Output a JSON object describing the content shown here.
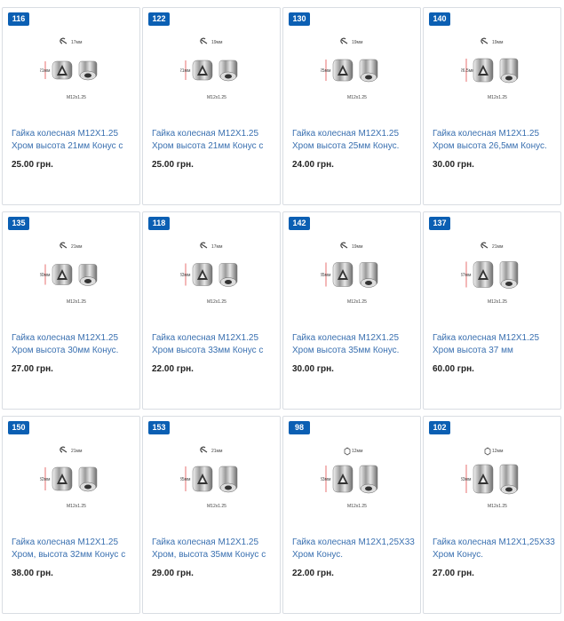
{
  "colors": {
    "badge": "#0b5fb3",
    "title_link": "#3a70b0",
    "border": "#d9dde3"
  },
  "products": [
    {
      "badge": "116",
      "size_label": "17мм",
      "height_label": "21мм",
      "thread_label": "M12x1.25",
      "title": "Гайка колесная M12X1.25 Хром высота 21мм Конус с",
      "price": "25.00 грн.",
      "icon": "wrench-icon"
    },
    {
      "badge": "122",
      "size_label": "19мм",
      "height_label": "21мм",
      "thread_label": "M12x1.25",
      "title": "Гайка колесная M12X1.25 Хром высота 21мм Конус с",
      "price": "25.00 грн.",
      "icon": "wrench-icon"
    },
    {
      "badge": "130",
      "size_label": "19мм",
      "height_label": "25мм",
      "thread_label": "M12x1.25",
      "title": "Гайка колесная M12X1.25 Хром высота 25мм Конус.",
      "price": "24.00 грн.",
      "icon": "wrench-icon"
    },
    {
      "badge": "140",
      "size_label": "19мм",
      "height_label": "26.5мм",
      "thread_label": "M12x1.25",
      "title": "Гайка колесная M12X1.25 Хром высота 26,5мм Конус.",
      "price": "30.00 грн.",
      "icon": "wrench-icon"
    },
    {
      "badge": "135",
      "size_label": "21мм",
      "height_label": "30мм",
      "thread_label": "M12x1.25",
      "title": "Гайка колесная M12X1.25 Хром высота 30мм Конус.",
      "price": "27.00 грн.",
      "icon": "wrench-icon"
    },
    {
      "badge": "118",
      "size_label": "17мм",
      "height_label": "33мм",
      "thread_label": "M12x1.25",
      "title": "Гайка колесная M12X1.25 Хром высота 33мм Конус с",
      "price": "22.00 грн.",
      "icon": "wrench-icon"
    },
    {
      "badge": "142",
      "size_label": "19мм",
      "height_label": "35мм",
      "thread_label": "M12x1.25",
      "title": "Гайка колесная M12X1.25 Хром высота 35мм Конус.",
      "price": "30.00 грн.",
      "icon": "wrench-icon"
    },
    {
      "badge": "137",
      "size_label": "21мм",
      "height_label": "37мм",
      "thread_label": "M12x1.25",
      "title": "Гайка колесная M12X1.25 Хром высота 37 мм",
      "price": "60.00 грн.",
      "icon": "wrench-icon"
    },
    {
      "badge": "150",
      "size_label": "21мм",
      "height_label": "32мм",
      "thread_label": "M12x1.25",
      "title": "Гайка колесная M12X1.25 Хром, высота 32мм Конус с",
      "price": "38.00 грн.",
      "icon": "wrench-icon"
    },
    {
      "badge": "153",
      "size_label": "21мм",
      "height_label": "35мм",
      "thread_label": "M12x1.25",
      "title": "Гайка колесная M12X1.25 Хром, высота 35мм Конус с",
      "price": "29.00 грн.",
      "icon": "wrench-icon"
    },
    {
      "badge": "98",
      "size_label": "12мм",
      "height_label": "33мм",
      "thread_label": "M12x1.25",
      "title": "Гайка колесная M12X1,25X33 Хром Конус.",
      "price": "22.00 грн.",
      "icon": "hex-icon"
    },
    {
      "badge": "102",
      "size_label": "12мм",
      "height_label": "33мм",
      "thread_label": "M12x1.25",
      "title": "Гайка колесная M12X1,25X33 Хром Конус.",
      "price": "27.00 грн.",
      "icon": "hex-icon"
    }
  ]
}
